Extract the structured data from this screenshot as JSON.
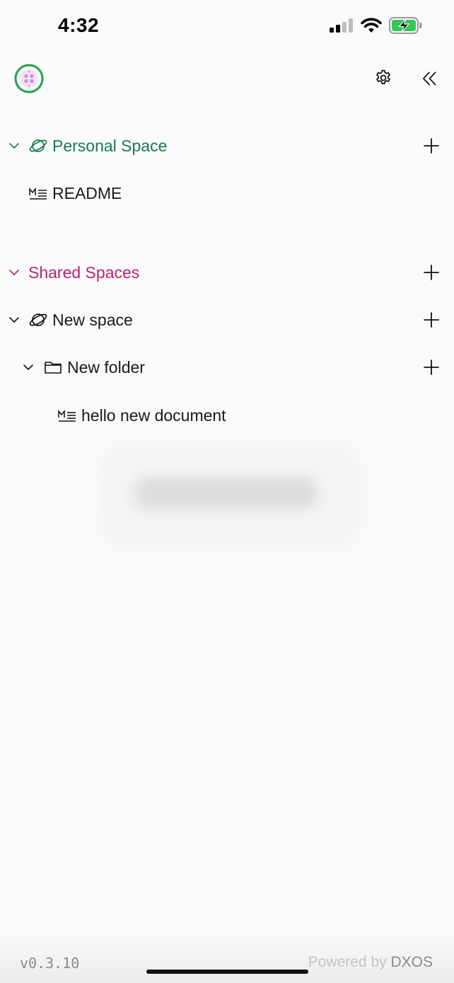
{
  "status_bar": {
    "time": "4:32",
    "icons": [
      "cellular-signal-icon",
      "wifi-icon",
      "battery-charging-icon"
    ]
  },
  "header": {
    "logo_icon": "app-logo-icon",
    "settings_icon": "gear-icon",
    "collapse_icon": "double-chevron-left-icon"
  },
  "colors": {
    "personal_space": "#1a7a4c",
    "shared_spaces": "#b5247a",
    "logo_ring": "#22a04a",
    "logo_dots": "#c98ad6"
  },
  "tree": {
    "personal_space": {
      "label": "Personal Space",
      "icon": "planet-icon",
      "children": [
        {
          "label": "README",
          "icon": "markdown-icon"
        }
      ]
    },
    "shared_spaces": {
      "label": "Shared Spaces",
      "spaces": [
        {
          "label": "New space",
          "icon": "planet-icon",
          "folders": [
            {
              "label": "New folder",
              "icon": "folder-icon",
              "documents": [
                {
                  "label": "hello new document",
                  "icon": "markdown-icon"
                }
              ]
            }
          ]
        }
      ]
    }
  },
  "footer": {
    "version": "v0.3.10",
    "powered_by_prefix": "Powered by ",
    "powered_by_brand": "DXOS"
  }
}
